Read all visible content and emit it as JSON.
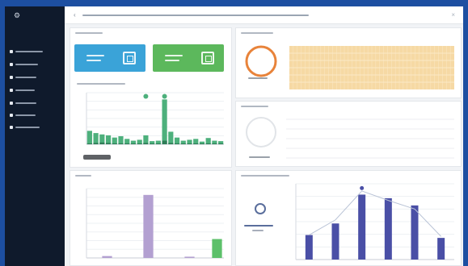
{
  "colors": {
    "outer_background": "#1d4fa1",
    "sidebar": "#0f1a2c",
    "card_blue": "#3aa3d8",
    "card_green": "#5cb85c",
    "bar_green": "#4db07c",
    "bar_purple": "#b3a0d1",
    "bar_lightgreen": "#5cc06a",
    "bar_navy": "#4a4fa6",
    "heat_fill": "#f6d9a4",
    "donut_ring": "#e8833a",
    "scroll_thumb": "#5f6266"
  },
  "sidebar": {
    "logo_icon": "app-logo-icon",
    "items": [
      {
        "icon": "menu-item-icon",
        "label": ""
      },
      {
        "icon": "menu-item-icon",
        "label": ""
      },
      {
        "icon": "menu-item-icon",
        "label": ""
      },
      {
        "icon": "menu-item-icon",
        "label": ""
      },
      {
        "icon": "menu-item-icon",
        "label": ""
      },
      {
        "icon": "menu-item-icon",
        "label": ""
      },
      {
        "icon": "menu-item-icon",
        "label": ""
      }
    ]
  },
  "header": {
    "back_icon": "back-arrow-icon",
    "title": "",
    "close_icon": "close-icon"
  },
  "panels": {
    "overview": {
      "title": "",
      "card_left": {
        "label": "",
        "icon": "document-icon"
      },
      "card_right": {
        "label": "",
        "icon": "document-icon"
      },
      "chart_title": ""
    },
    "heat_panel": {
      "title": "",
      "donut_value": "",
      "donut_label": ""
    },
    "status_panel": {
      "title": "",
      "donut_label": ""
    },
    "bottom_left": {
      "title": ""
    },
    "bottom_right": {
      "title": "",
      "logo_text": ""
    }
  },
  "chart_data": [
    {
      "type": "bar",
      "name": "overview-bars",
      "title": "",
      "series": [
        {
          "values": [
            0.3,
            0.25,
            0.22,
            0.2,
            0.15,
            0.18,
            0.12,
            0.08,
            0.1,
            0.2,
            0.07,
            0.08,
            1.0,
            0.28,
            0.15,
            0.08,
            0.1,
            0.12,
            0.06,
            0.14,
            0.08,
            0.07
          ]
        },
        {
          "values": [
            0.02,
            0.03,
            0.04,
            0.03,
            0.02,
            0.02,
            0.02,
            0.01,
            0.01,
            0.03,
            0.01,
            0.01,
            0.08,
            0.03,
            0.02,
            0.01,
            0.01,
            0.02,
            0.01,
            0.02,
            0.01,
            0.01
          ]
        }
      ],
      "markers": [
        {
          "index": 9,
          "y": 1.07
        },
        {
          "index": 12,
          "y": 1.07
        }
      ],
      "ylim": [
        0,
        1.15
      ]
    },
    {
      "type": "heatmap",
      "name": "heat-strip",
      "rows": 6,
      "cols": 42,
      "fill": "uniform"
    },
    {
      "type": "bar",
      "name": "left-bars",
      "series": [
        {
          "values": [
            0,
            0.03,
            0,
            0,
            1.0,
            0,
            0,
            0.02,
            0,
            0.3
          ]
        }
      ],
      "colors": [
        "#b3a0d1",
        "#b3a0d1",
        "#b3a0d1",
        "#b3a0d1",
        "#b3a0d1",
        "#b3a0d1",
        "#b3a0d1",
        "#b3a0d1",
        "#b3a0d1",
        "#5cc06a"
      ],
      "ylim": [
        0,
        1.1
      ]
    },
    {
      "type": "bar",
      "name": "right-bars",
      "series": [
        {
          "values": [
            0.34,
            0.5,
            0.9,
            0.85,
            0.75,
            0.3
          ]
        },
        {
          "values": [
            0.34,
            0.55,
            0.95,
            0.82,
            0.7,
            0.32
          ],
          "type": "line"
        }
      ],
      "markers": [
        {
          "index": 2,
          "y": 0.99
        }
      ],
      "ylim": [
        0,
        1.05
      ]
    }
  ]
}
